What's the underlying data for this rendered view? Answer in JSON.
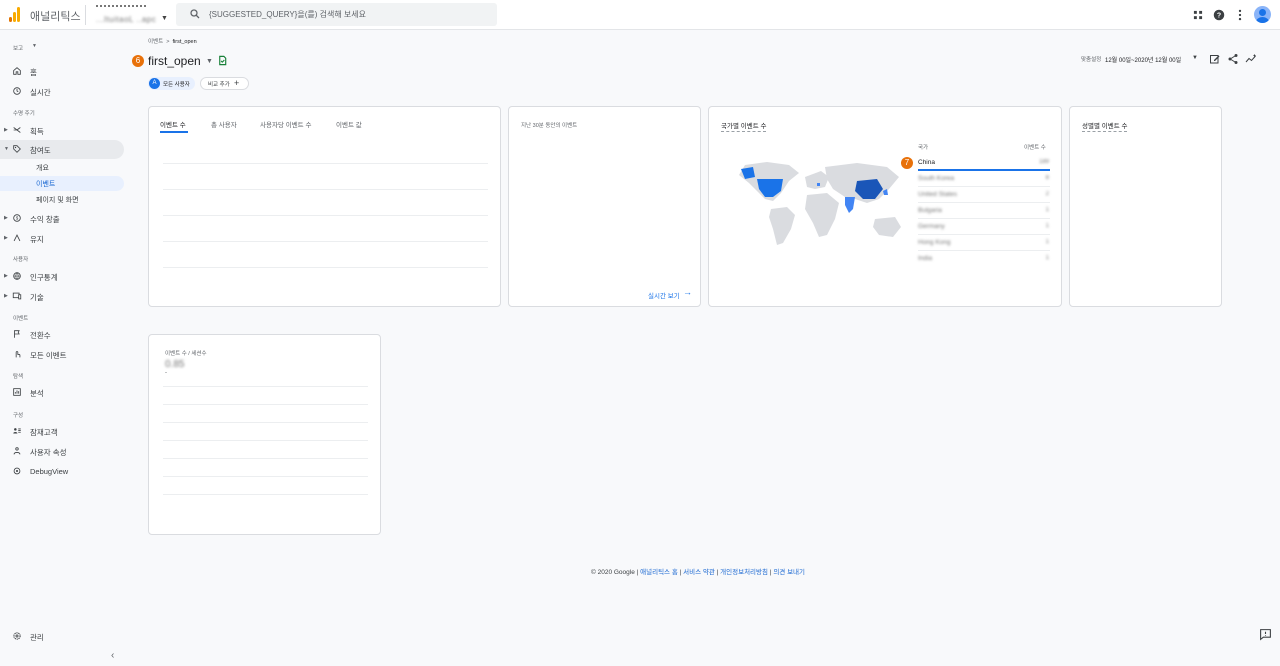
{
  "topbar": {
    "brand": "애널리틱스",
    "account_name": "M.",
    "account_sub": "...ltuitaoL ..apc",
    "search_placeholder": "{SUGGESTED_QUERY}을(를) 검색해 보세요"
  },
  "sidebar": {
    "report_label": "보고",
    "home": "홈",
    "realtime": "실시간",
    "lifecycle_header": "수명 주기",
    "acquisition": "획득",
    "engagement": "참여도",
    "overview": "개요",
    "events": "이벤트",
    "pages_screens": "페이지 및 화면",
    "monetization": "수익 창출",
    "retention": "유지",
    "user_header": "사용자",
    "demographics": "인구통계",
    "tech": "기술",
    "event_header": "이벤트",
    "conversions": "전환수",
    "all_events": "모든 이벤트",
    "explore_header": "탐색",
    "analysis": "분석",
    "config_header": "구성",
    "audiences": "잠재고객",
    "user_properties": "사용자 속성",
    "debugview": "DebugView",
    "admin": "관리"
  },
  "header": {
    "breadcrumb_parent": "이벤트",
    "breadcrumb_current": "first_open",
    "badge_6": "6",
    "title": "first_open",
    "chip_all_users": "모든 사용자",
    "chip_all_users_icon_letter": "A",
    "chip_compare": "비교 추가",
    "date_label": "맞춤설정",
    "date_value": "12월 00일~2020년 12월 00일"
  },
  "card_events": {
    "tabs": [
      "이벤트 수",
      "총 사용자",
      "사용자당 이벤트 수",
      "이벤트 값"
    ]
  },
  "card_realtime": {
    "label": "지난 30분 동안의 이벤트",
    "link": "실시간 보기"
  },
  "card_country": {
    "title": "국가별 이벤트 수",
    "col_country": "국가",
    "col_events": "이벤트 수",
    "badge_7": "7",
    "rows": [
      {
        "name": "China",
        "value": "189"
      },
      {
        "name": "South Korea",
        "value": "8"
      },
      {
        "name": "United States",
        "value": "2"
      },
      {
        "name": "Bulgaria",
        "value": "1"
      },
      {
        "name": "Germany",
        "value": "1"
      },
      {
        "name": "Hong Kong",
        "value": "1"
      },
      {
        "name": "India",
        "value": "1"
      }
    ]
  },
  "card_gender": {
    "title": "성별별 이벤트 수"
  },
  "card_per_session": {
    "label": "이벤트 수 / 세션수",
    "value": "0.85",
    "sub": "-"
  },
  "footer": {
    "copyright": "© 2020 Google | ",
    "link_home": "애널리틱스 홈",
    "sep": " | ",
    "link_terms": "서비스 약관",
    "link_privacy": "개인정보처리방침",
    "link_feedback": "의견 보내기"
  },
  "colors": {
    "accent": "#1a73e8",
    "badge": "#e8710a",
    "map_dark": "#1a56b8",
    "map_mid": "#4285f4",
    "map_land": "#dadce0"
  }
}
